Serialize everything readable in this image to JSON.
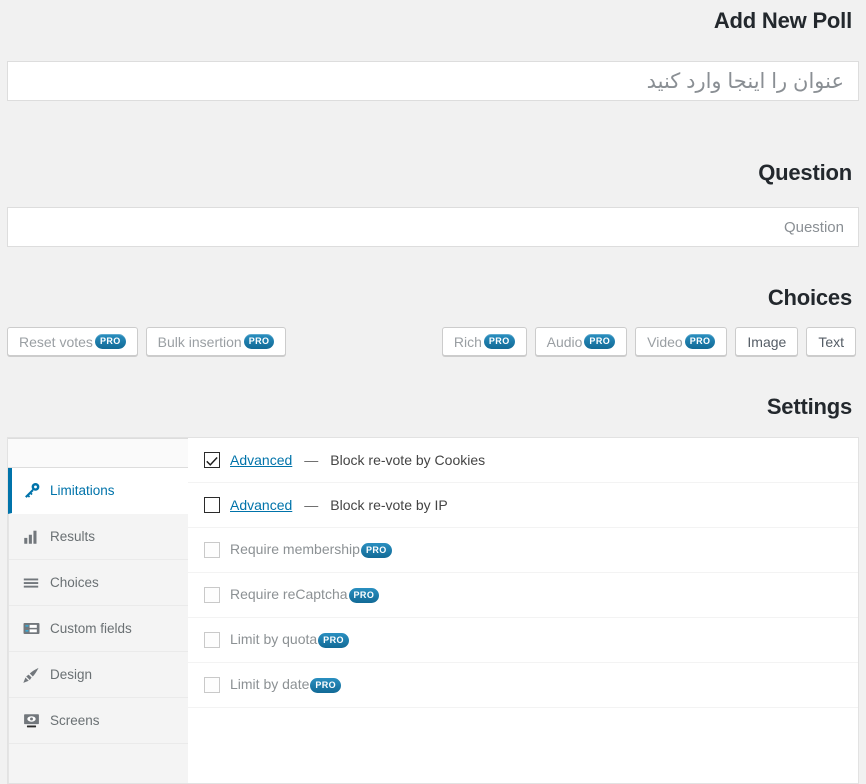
{
  "page": {
    "title_heading": "Add New Poll",
    "question_heading": "Question",
    "choices_heading": "Choices",
    "settings_heading": "Settings"
  },
  "title_field": {
    "value": "",
    "placeholder": "عنوان را اینجا وارد کنید"
  },
  "question_field": {
    "value": "",
    "placeholder": "Question"
  },
  "choices_toolbar": {
    "type_buttons": [
      {
        "label": "Text",
        "pro": false,
        "badge": ""
      },
      {
        "label": "Image",
        "pro": false,
        "badge": ""
      },
      {
        "label": "Video",
        "pro": true,
        "badge": "PRO"
      },
      {
        "label": "Audio",
        "pro": true,
        "badge": "PRO"
      },
      {
        "label": "Rich",
        "pro": true,
        "badge": "PRO"
      }
    ],
    "action_buttons": [
      {
        "label": "Reset votes",
        "pro": true,
        "badge": "PRO"
      },
      {
        "label": "Bulk insertion",
        "pro": true,
        "badge": "PRO"
      }
    ]
  },
  "settings": {
    "tabs": [
      {
        "label": "",
        "icon": "blank-tab",
        "active": false,
        "partial": true
      },
      {
        "label": "Limitations",
        "icon": "key-icon",
        "active": true,
        "partial": false
      },
      {
        "label": "Results",
        "icon": "bar-chart-icon",
        "active": false,
        "partial": false
      },
      {
        "label": "Choices",
        "icon": "list-icon",
        "active": false,
        "partial": false
      },
      {
        "label": "Custom fields",
        "icon": "form-fields-icon",
        "active": false,
        "partial": false
      },
      {
        "label": "Design",
        "icon": "brush-icon",
        "active": false,
        "partial": false
      },
      {
        "label": "Screens",
        "icon": "monitor-icon",
        "active": false,
        "partial": false
      }
    ],
    "rows": [
      {
        "label": "Block re-vote by Cookies",
        "pro": false,
        "badge": "",
        "dash": "—",
        "advanced_label": "Advanced",
        "checked": true,
        "disabled": false
      },
      {
        "label": "Block re-vote by IP",
        "pro": false,
        "badge": "",
        "dash": "—",
        "advanced_label": "Advanced",
        "checked": false,
        "disabled": false
      },
      {
        "label": "Require membership",
        "pro": true,
        "badge": "PRO",
        "dash": "",
        "advanced_label": "",
        "checked": false,
        "disabled": true
      },
      {
        "label": "Require reCaptcha",
        "pro": true,
        "badge": "PRO",
        "dash": "",
        "advanced_label": "",
        "checked": false,
        "disabled": true
      },
      {
        "label": "Limit by quota",
        "pro": true,
        "badge": "PRO",
        "dash": "",
        "advanced_label": "",
        "checked": false,
        "disabled": true
      },
      {
        "label": "Limit by date",
        "pro": true,
        "badge": "PRO",
        "dash": "",
        "advanced_label": "",
        "checked": false,
        "disabled": true
      }
    ]
  },
  "colors": {
    "background": "#f1f1f1",
    "accent": "#0073aa",
    "pro_badge": "#1a7cae",
    "heading": "#23282d",
    "panel": "#ffffff",
    "tabs_bg": "#f4f4f4"
  }
}
